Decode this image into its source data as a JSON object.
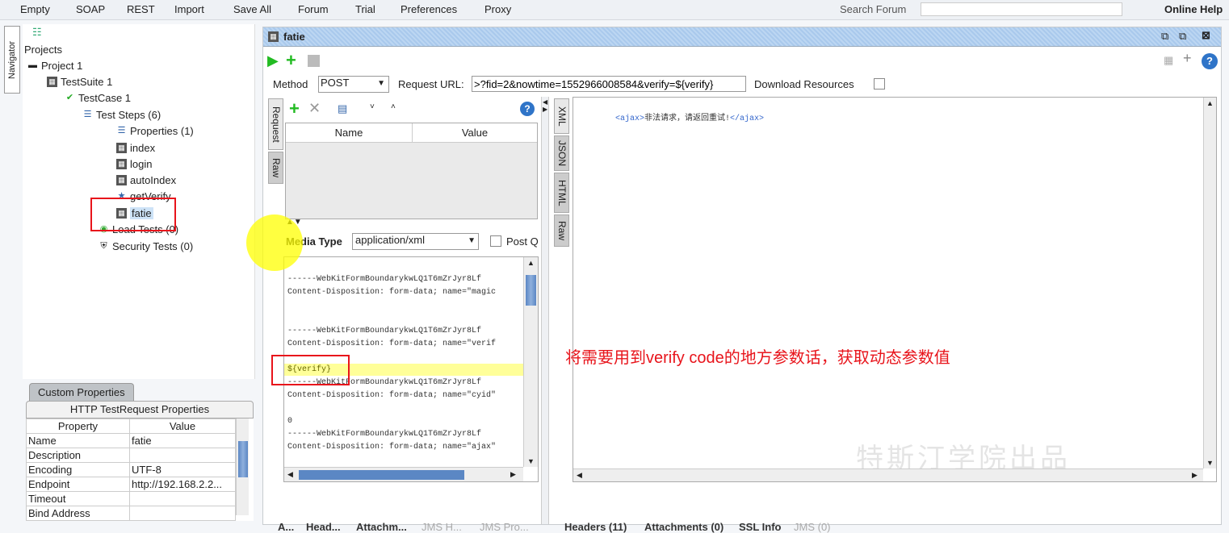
{
  "menu": [
    "Empty",
    "SOAP",
    "REST",
    "Import",
    "Save All",
    "Forum",
    "Trial",
    "Preferences",
    "Proxy"
  ],
  "search_label": "Search Forum",
  "online_help": "Online Help",
  "navigator": "Navigator",
  "tree": {
    "root": "Projects",
    "project": "Project 1",
    "suite": "TestSuite 1",
    "case": "TestCase 1",
    "steps": "Test Steps (6)",
    "items": [
      "Properties (1)",
      "index",
      "login",
      "autoIndex",
      "getVerify",
      "fatie"
    ],
    "load": "Load Tests (0)",
    "security": "Security Tests (0)"
  },
  "props": {
    "tab": "Custom Properties",
    "title": "HTTP TestRequest Properties",
    "headers": [
      "Property",
      "Value"
    ],
    "rows": [
      [
        "Name",
        "fatie"
      ],
      [
        "Description",
        ""
      ],
      [
        "Encoding",
        "UTF-8"
      ],
      [
        "Endpoint",
        "http://192.168.2.2..."
      ],
      [
        "Timeout",
        ""
      ],
      [
        "Bind Address",
        ""
      ]
    ]
  },
  "editor": {
    "title": "fatie",
    "method_label": "Method",
    "method": "POST",
    "url_label": "Request URL:",
    "url": ">?fid=2&nowtime=1552966008584&verify=${verify}",
    "download": "Download Resources",
    "req_tabs": [
      "Request",
      "Raw"
    ],
    "param_headers": [
      "Name",
      "Value"
    ],
    "media_label": "Media Type",
    "media": "application/xml",
    "post_label": "Post QueryString",
    "body_lines": [
      "",
      "------WebKitFormBoundarykwLQ1T6mZrJyr8Lf",
      "Content-Disposition: form-data; name=\"magic",
      "",
      "",
      "------WebKitFormBoundarykwLQ1T6mZrJyr8Lf",
      "Content-Disposition: form-data; name=\"verif",
      "",
      "${verify}",
      "------WebKitFormBoundarykwLQ1T6mZrJyr8Lf",
      "Content-Disposition: form-data; name=\"cyid\"",
      "",
      "0",
      "------WebKitFormBoundarykwLQ1T6mZrJyr8Lf",
      "Content-Disposition: form-data; name=\"ajax\""
    ],
    "req_bottom": [
      "A...",
      "Head...",
      "Attachm...",
      "JMS H...",
      "JMS Pro..."
    ],
    "resp_tabs": [
      "XML",
      "JSON",
      "HTML",
      "Raw"
    ],
    "resp_open": "<ajax>",
    "resp_text": "非法请求，请返回重试!",
    "resp_close": "</ajax>",
    "resp_bottom": [
      "Headers (11)",
      "Attachments (0)",
      "SSL Info",
      "JMS (0)"
    ]
  },
  "annotation": "将需要用到verify code的地方参数话，获取动态参数值",
  "watermark": "特斯汀学院出品",
  "colors": {
    "annotation": "#e8141b",
    "header": "#bcd6f2",
    "highlight": "#ffff99"
  }
}
